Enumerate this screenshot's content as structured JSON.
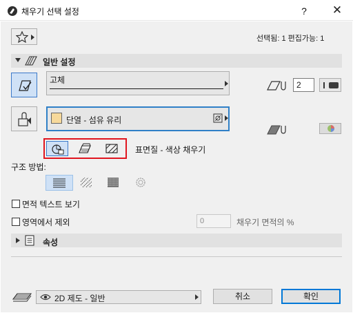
{
  "window": {
    "title": "채우기 선택 설정",
    "help_label": "?",
    "close_label": "✕"
  },
  "header": {
    "selection_info": "선택됨: 1 편집가능: 1"
  },
  "general_section": {
    "label": "일반 설정"
  },
  "fill_type": {
    "selected": "고체"
  },
  "pen": {
    "value": "2"
  },
  "material": {
    "selected": "단열 - 섬유 유리",
    "swatch_color": "#f7d99b"
  },
  "fill_mode": {
    "label": "표면질 - 색상 채우기"
  },
  "structure": {
    "label": "구조 방법:"
  },
  "options": {
    "show_area_text": "면적 텍스트 보기",
    "exclude_from_zone": "영역에서 제외",
    "fill_area_percent_value": "0",
    "fill_area_percent_label": "채우기 면적의 %"
  },
  "properties_section": {
    "label": "속성"
  },
  "footer": {
    "layer": "2D 제도 - 일반",
    "cancel_label": "취소",
    "ok_label": "확인"
  },
  "colors": {
    "accent_blue": "#0078d7",
    "highlight_red": "#e0141e",
    "selected_bg": "#cfe1f6"
  }
}
